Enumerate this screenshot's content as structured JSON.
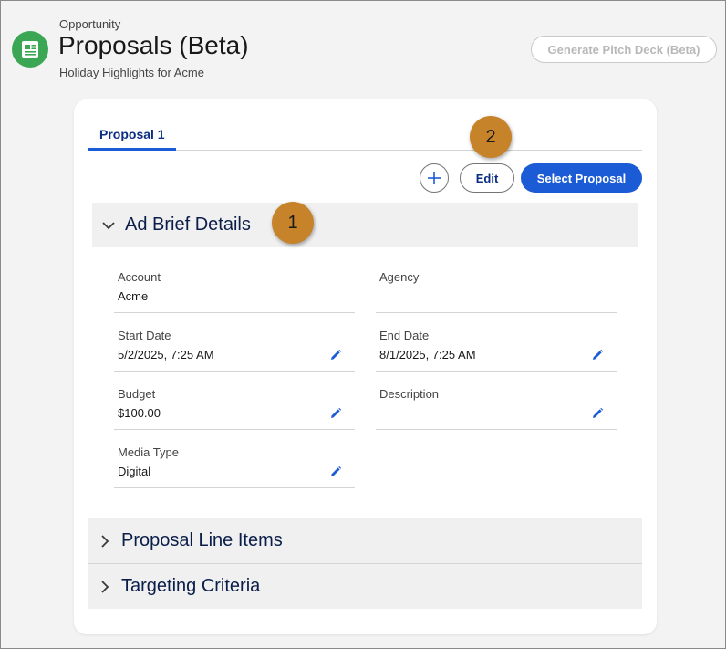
{
  "header": {
    "object_label": "Opportunity",
    "title": "Proposals (Beta)",
    "subtitle": "Holiday Highlights for Acme",
    "pitch_button": "Generate Pitch Deck (Beta)"
  },
  "tabs": [
    {
      "label": "Proposal 1",
      "active": true
    }
  ],
  "toolbar": {
    "add_icon": "plus-icon",
    "edit_label": "Edit",
    "select_label": "Select Proposal"
  },
  "sections": {
    "ad_brief": {
      "label": "Ad Brief Details",
      "expanded": true,
      "fields": {
        "account": {
          "label": "Account",
          "value": "Acme"
        },
        "agency": {
          "label": "Agency",
          "value": ""
        },
        "start_date": {
          "label": "Start Date",
          "value": "5/2/2025, 7:25 AM"
        },
        "end_date": {
          "label": "End Date",
          "value": "8/1/2025, 7:25 AM"
        },
        "budget": {
          "label": "Budget",
          "value": "$100.00"
        },
        "description": {
          "label": "Description",
          "value": ""
        },
        "media_type": {
          "label": "Media Type",
          "value": "Digital"
        }
      }
    },
    "line_items": {
      "label": "Proposal Line Items",
      "expanded": false
    },
    "targeting": {
      "label": "Targeting Criteria",
      "expanded": false
    }
  },
  "callouts": {
    "one": "1",
    "two": "2"
  },
  "colors": {
    "brand_blue": "#1b5bd6",
    "icon_green": "#3ba755",
    "callout_orange": "#c7832a"
  }
}
